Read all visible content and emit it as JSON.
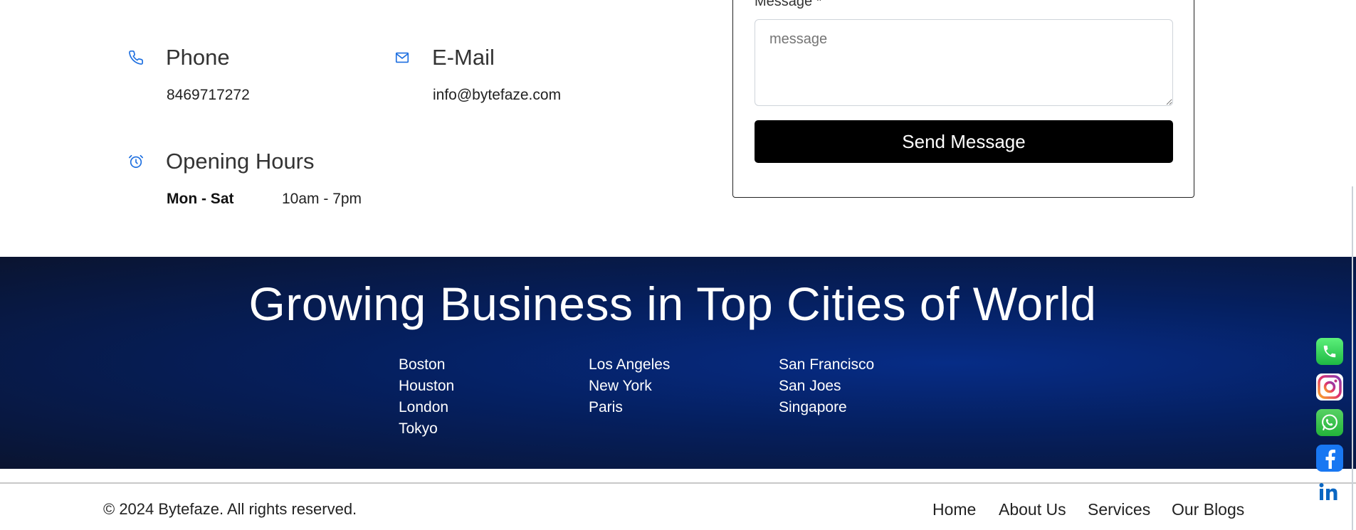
{
  "contact": {
    "phone_title": "Phone",
    "phone_value": "8469717272",
    "email_title": "E-Mail",
    "email_value": "info@bytefaze.com",
    "hours_title": "Opening Hours",
    "hours_days": "Mon - Sat",
    "hours_time": "10am - 7pm"
  },
  "form": {
    "message_label": "Message *",
    "message_placeholder": "message",
    "send_label": "Send Message"
  },
  "cities": {
    "title": "Growing Business in Top Cities of World",
    "columns": [
      [
        "Boston",
        "Houston",
        "London",
        "Tokyo"
      ],
      [
        "Los Angeles",
        "New York",
        "Paris"
      ],
      [
        "San Francisco",
        "San Joes",
        "Singapore"
      ]
    ]
  },
  "footer": {
    "copyright": "© 2024 Bytefaze. All rights reserved.",
    "nav": [
      "Home",
      "About Us",
      "Services",
      "Our Blogs"
    ]
  },
  "social": {
    "phone_color": "#25d366",
    "whatsapp_color": "#25d366",
    "facebook_color": "#1877f2",
    "linkedin_color": "#0a66c2"
  },
  "colors": {
    "accent_icon": "#1d6fe0",
    "band_dark": "#0a1430",
    "band_mid": "#062c86"
  }
}
